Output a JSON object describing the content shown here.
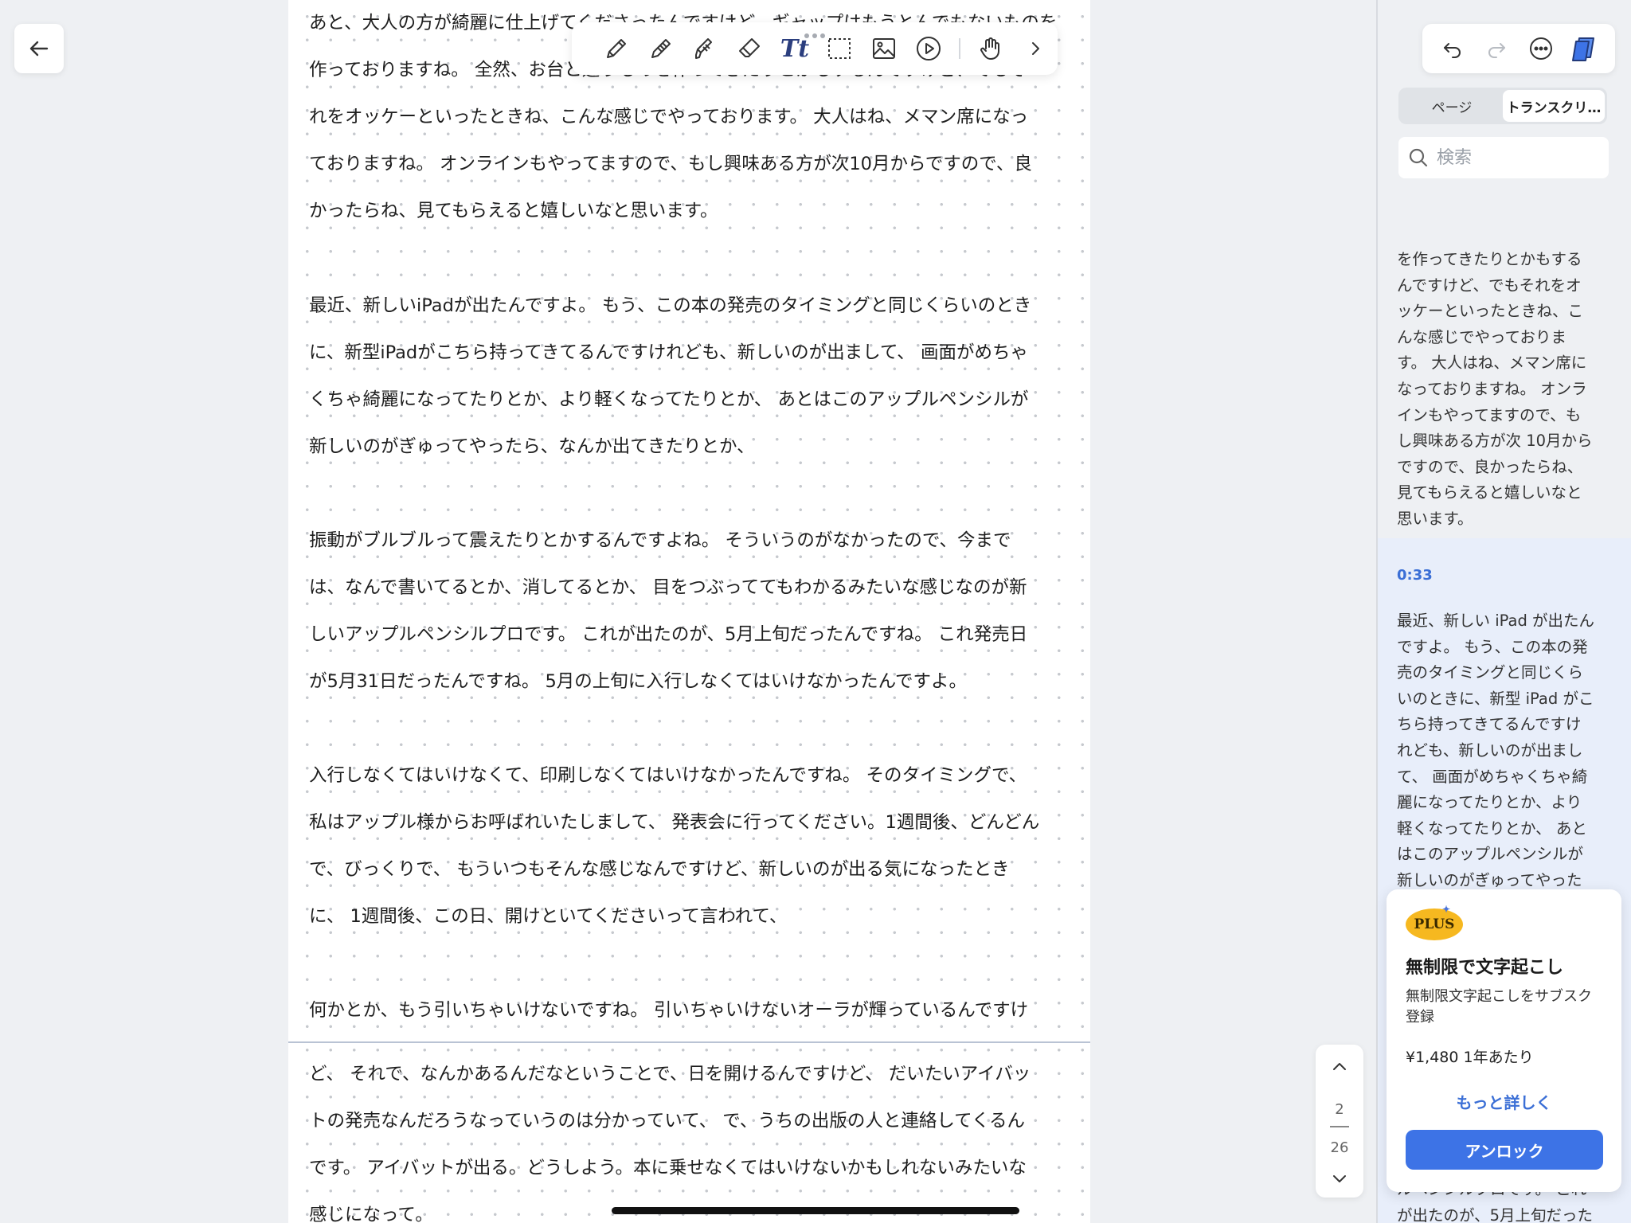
{
  "document": {
    "paragraphs": [
      [
        "あと、大人の方が綺麗に仕上げてくださったんですけど、ギャップはもうとんでもないものを",
        "作っておりますね。 全然、お台と違うものを作ってきたりとかもするんですけど、でもそ",
        "れをオッケーといったときね、こんな感じでやっております。 大人はね、メマン席になっ",
        "ておりますね。 オンラインもやってますので、もし興味ある方が次10月からですので、良",
        "かったらね、見てもらえると嬉しいなと思います。"
      ],
      [
        "最近、新しいiPadが出たんですよ。 もう、この本の発売のタイミングと同じくらいのとき",
        "に、新型iPadがこちら持ってきてるんですけれども、新しいのが出まして、 画面がめちゃ",
        "くちゃ綺麗になってたりとか、より軽くなってたりとか、 あとはこのアップルペンシルが",
        "新しいのがぎゅってやったら、なんか出てきたりとか、"
      ],
      [
        "振動がブルブルって震えたりとかするんですよね。 そういうのがなかったので、今まで",
        "は、なんで書いてるとか、消してるとか、 目をつぶっててもわかるみたいな感じなのが新",
        "しいアップルペンシルプロです。 これが出たのが、5月上旬だったんですね。 これ発売日",
        "が5月31日だったんですね。 5月の上旬に入行しなくてはいけなかったんですよ。"
      ],
      [
        "入行しなくてはいけなくて、印刷しなくてはいけなかったんですね。 そのタイミングで、",
        "私はアップル様からお呼ばれいたしまして、 発表会に行ってください。1週間後、どんどん",
        "で、びっくりで、 もういつもそんな感じなんですけど、新しいのが出る気になったとき",
        "に、 1週間後、この日、開けといてくださいって言われて、"
      ],
      [
        "何かとか、もう引いちゃいけないですね。 引いちゃいけないオーラが輝っているんですけ"
      ],
      [
        "ど、 それで、なんかあるんだなということで、日を開けるんですけど、 だいたいアイバッ",
        "トの発売なんだろうなっていうのは分かっていて、 で、うちの出版の人と連絡してくるん",
        "です。 アイバットが出る。どうしよう。本に乗せなくてはいけないかもしれないみたいな",
        "感じになって。"
      ]
    ]
  },
  "toolbar": {
    "tools": [
      "pen-icon",
      "pencil-icon",
      "highlighter-icon",
      "eraser-icon",
      "text-tool-icon",
      "lasso-select-icon",
      "image-icon",
      "play-icon",
      "hand-icon",
      "chevron-right-icon"
    ],
    "text_tool_label": "Tt"
  },
  "pager": {
    "current": "2",
    "total": "26"
  },
  "sidebar": {
    "tabs": [
      {
        "label": "ページ",
        "active": false
      },
      {
        "label": "トランスクリ…",
        "active": true
      }
    ],
    "search_placeholder": "検索",
    "transcript_top": [
      "を作ってきたりとかもする",
      "んですけど、でもそれをオ",
      "ッケーといったときね、こ",
      "んな感じでやっておりま",
      "す。 大人はね、メマン席に",
      "なっておりますね。 オンラ",
      "インもやってますので、も",
      "し興味ある方が次 10月から",
      "ですので、良かったらね、",
      "見てもらえると嬉しいなと",
      "思います。"
    ],
    "timestamp": "0:33",
    "transcript_active": [
      "最近、新しい iPad が出たん",
      "ですよ。 もう、この本の発",
      "売のタイミングと同じくら",
      "いのときに、新型 iPad がこ",
      "ちら持ってきてるんですけ",
      "れども、新しいのが出まし",
      "て、 画面がめちゃくちゃ綺",
      "麗になってたりとか、より",
      "軽くなってたりとか、 あと",
      "はこのアップルペンシルが",
      "新しいのがぎゅってやった"
    ],
    "transcript_bottom": [
      "ルペンシルプロです。 これ",
      "が出たのが、5月上旬だった"
    ]
  },
  "upsell": {
    "badge": "PLUS",
    "title": "無制限で文字起こし",
    "description": "無制限文字起こしをサブスク登録",
    "price": "¥1,480 1年あたり",
    "more_link": "もっと詳しく",
    "unlock_button": "アンロック"
  },
  "colors": {
    "accent": "#3d73e6",
    "link": "#3b6fd6",
    "badge": "#f6b820",
    "highlight": "#e8eefa"
  }
}
